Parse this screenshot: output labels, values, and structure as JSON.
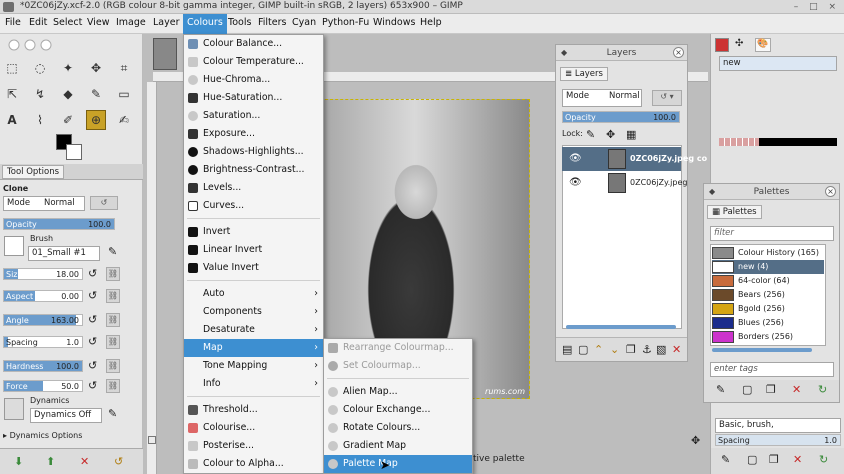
{
  "window": {
    "title": "*0ZC06jZy.xcf-2.0 (RGB colour 8-bit gamma integer, GIMP built-in sRGB, 2 layers) 653x900 – GIMP",
    "controls": "– □ ×"
  },
  "menubar": [
    "File",
    "Edit",
    "Select",
    "View",
    "Image",
    "Layer",
    "Colours",
    "Tools",
    "Filters",
    "Cyan",
    "Python-Fu",
    "Windows",
    "Help"
  ],
  "tool_options": {
    "tab": "Tool Options",
    "tool_name": "Clone",
    "mode_label": "Mode",
    "mode_value": "Normal",
    "opacity": {
      "label": "Opacity",
      "value": "100.0",
      "fraction": 1.0
    },
    "brush_label": "Brush",
    "brush_value": "01_Small #1",
    "size": {
      "label": "Size",
      "value": "18.00",
      "fraction": 0.18
    },
    "aspect": {
      "label": "Aspect Ratio",
      "value": "0.00",
      "fraction": 0.5
    },
    "angle": {
      "label": "Angle",
      "value": "163.00",
      "fraction": 0.95
    },
    "spacing": {
      "label": "Spacing",
      "value": "1.0",
      "fraction": 0.05
    },
    "hardness": {
      "label": "Hardness",
      "value": "100.0",
      "fraction": 1.0
    },
    "force": {
      "label": "Force",
      "value": "50.0",
      "fraction": 0.5
    },
    "dynamics_label": "Dynamics",
    "dynamics_value": "Dynamics Off",
    "dynamics_options": "Dynamics Options"
  },
  "colours_menu": {
    "items": [
      "Colour Balance...",
      "Colour Temperature...",
      "Hue-Chroma...",
      "Hue-Saturation...",
      "Saturation...",
      "Exposure...",
      "Shadows-Highlights...",
      "Brightness-Contrast...",
      "Levels...",
      "Curves...",
      "Invert",
      "Linear Invert",
      "Value Invert",
      "Auto",
      "Components",
      "Desaturate",
      "Map",
      "Tone Mapping",
      "Info",
      "Threshold...",
      "Colourise...",
      "Posterise...",
      "Colour to Alpha..."
    ]
  },
  "map_menu": {
    "items": [
      "Rearrange Colourmap...",
      "Set Colourmap...",
      "Alien Map...",
      "Colour Exchange...",
      "Rotate Colours...",
      "Gradient Map",
      "Palette Map"
    ]
  },
  "canvas": {
    "watermark": "rums.com",
    "status_hint": "tive palette"
  },
  "layers": {
    "title": "Layers",
    "tab": "Layers",
    "mode_label": "Mode",
    "mode_value": "Normal",
    "opacity_label": "Opacity",
    "opacity_value": "100.0",
    "lock_label": "Lock:",
    "rows": [
      "0ZC06jZy.jpeg co",
      "0ZC06jZy.jpeg"
    ]
  },
  "palettes": {
    "title": "Palettes",
    "tab": "Palettes",
    "filter_placeholder": "filter",
    "tags_placeholder": "enter tags",
    "items": [
      {
        "name": "Colour History (165)",
        "color": "#8a8a8a"
      },
      {
        "name": "new (4)",
        "color": "#ffffff"
      },
      {
        "name": "64-color (64)",
        "color": "#c86b3c"
      },
      {
        "name": "Bears (256)",
        "color": "#6b4a2a"
      },
      {
        "name": "Bgold (256)",
        "color": "#d4a514"
      },
      {
        "name": "Blues (256)",
        "color": "#1b2c8c"
      },
      {
        "name": "Borders (256)",
        "color": "#cc33cc"
      }
    ]
  },
  "right_panel": {
    "palette_name": "new",
    "brush_filter": "Basic, brush,",
    "spacing_label": "Spacing",
    "spacing_value": "1.0"
  },
  "colors": {
    "accent": "#3d8fd1",
    "selected_layer": "#546e87",
    "slider_fill": "#6c9ccc"
  }
}
